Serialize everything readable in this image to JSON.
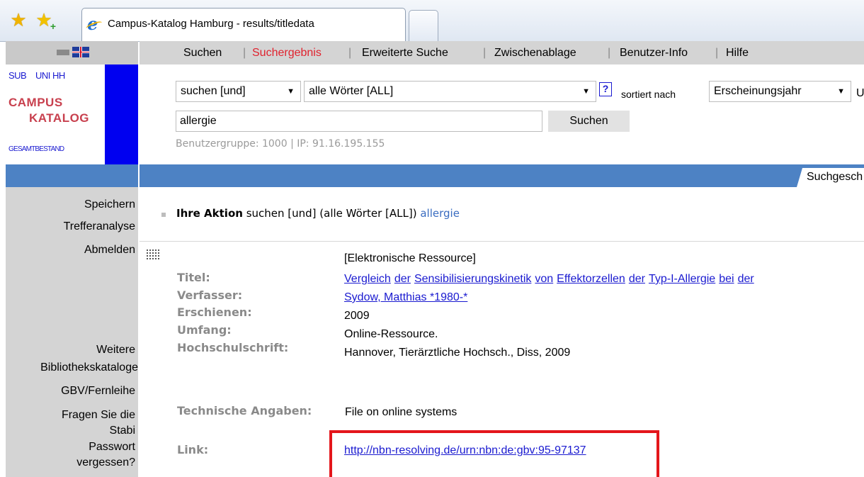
{
  "browser": {
    "tab_title": "Campus-Katalog Hamburg - results/titledata",
    "favorites_icon": "star-icon",
    "add_favorites_icon": "add-favorite-icon"
  },
  "topnav": {
    "items": [
      "Suchen",
      "Suchergebnis",
      "Erweiterte Suche",
      "Zwischenablage",
      "Benutzer-Info",
      "Hilfe"
    ],
    "active": "Suchergebnis",
    "separator": "|"
  },
  "logo": {
    "sub": "SUB",
    "uni": "UNI HH",
    "campus": "CAMPUS",
    "katalog": "KATALOG",
    "gesamt": "GESAMTBESTAND"
  },
  "search": {
    "operator": "suchen [und]",
    "field": "alle Wörter [ALL]",
    "help": "?",
    "sorted_label": "sortiert nach",
    "sort_value": "Erscheinungsjahr",
    "cut_letter": "U",
    "query": "allergie",
    "button": "Suchen",
    "usergroup": "Benutzergruppe: 1000 | IP: 91.16.195.155"
  },
  "history_tab": "Suchgesch",
  "leftnav": {
    "speichern": "Speichern",
    "trefferanalyse": "Trefferanalyse",
    "abmelden": "Abmelden",
    "weitere_1": "Weitere",
    "weitere_2": "Bibliothekskataloge",
    "gbv": "GBV/Fernleihe",
    "fragen_1": "Fragen Sie die",
    "fragen_2": "Stabi",
    "passwort_1": "Passwort",
    "passwort_2": "vergessen?"
  },
  "action": {
    "label": "Ihre Aktion",
    "text": "suchen [und] (alle Wörter [ALL])",
    "term": "allergie"
  },
  "record": {
    "type": "[Elektronische Ressource]",
    "fields": {
      "titel_label": "Titel:",
      "titel_words": [
        "Vergleich",
        "der",
        "Sensibilisierungskinetik",
        "von",
        "Effektorzellen",
        "der",
        "Typ-I-Allergie",
        "bei",
        "der"
      ],
      "verfasser_label": "Verfasser:",
      "verfasser": "Sydow, Matthias *1980-*",
      "erschienen_label": "Erschienen:",
      "erschienen": "2009",
      "umfang_label": "Umfang:",
      "umfang": "Online-Ressource.",
      "hochschulschrift_label": "Hochschulschrift:",
      "hochschulschrift": "Hannover, Tierärztliche Hochsch., Diss, 2009",
      "technische_label": "Technische Angaben:",
      "technische": "File on online systems",
      "link_label": "Link:",
      "link": "http://nbn-resolving.de/urn:nbn:de:gbv:95-97137"
    }
  },
  "colors": {
    "nav_gray": "#d4d4d4",
    "blue_bar": "#4d82c4",
    "active_red": "#e0222e",
    "link_blue": "#1a1ad0",
    "highlight_red": "#e4161b"
  }
}
